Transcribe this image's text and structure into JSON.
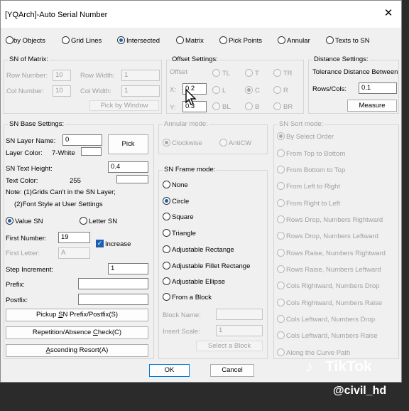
{
  "window": {
    "title": "[YQArch]-Auto Serial Number",
    "close": "✕"
  },
  "modes": [
    "by Objects",
    "Grid Lines",
    "Intersected",
    "Matrix",
    "Pick Points",
    "Annular",
    "Texts to SN"
  ],
  "matrix": {
    "title": "SN of Matrix:",
    "row_number_label": "Row Number:",
    "row_number": "10",
    "row_width_label": "Row Width:",
    "row_width": "1",
    "col_number_label": "Col Number:",
    "col_number": "10",
    "col_width_label": "Col Width:",
    "col_width": "1",
    "pick_button": "Pick by Window"
  },
  "offset": {
    "title": "Offset Settings:",
    "offset_label": "Offset",
    "x_label": "X:",
    "x_value": "0.2",
    "y_label": "Y:",
    "y_value": "0.3",
    "positions": [
      "TL",
      "T",
      "TR",
      "L",
      "C",
      "R",
      "BL",
      "B",
      "BR"
    ]
  },
  "distance": {
    "title": "Distance Settings:",
    "tolerance_label": "Tolerance Distance Between",
    "rows_cols_label": "Rows/Cols:",
    "rows_cols_value": "0.1",
    "measure_button": "Measure"
  },
  "base": {
    "title": "SN Base Settings:",
    "layer_name_label": "SN Layer Name:",
    "layer_name": "0",
    "pick_button": "Pick",
    "layer_color_label": "Layer Color:",
    "layer_color": "7-White",
    "text_height_label": "SN Text Height:",
    "text_height": "0.4",
    "text_color_label": "Text Color:",
    "text_color": "255",
    "note1": "Note: (1)Grids Can't in the SN Layer;",
    "note2": "(2)Font Style at User Settings",
    "value_sn": "Value SN",
    "letter_sn": "Letter SN",
    "first_number_label": "First Number:",
    "first_number": "19",
    "increase_label": "Increase",
    "first_letter_label": "First Letter:",
    "first_letter": "A",
    "step_label": "Step Increment:",
    "step_value": "1",
    "prefix_label": "Prefix:",
    "prefix": "",
    "postfix_label": "Postfix:",
    "postfix": "",
    "pickup_pre": "Pickup ",
    "pickup_u": "S",
    "pickup_post": "N Prefix/Postfix(S)",
    "repetition_pre": "Repetition/Absence ",
    "repetition_u": "C",
    "repetition_post": "heck(C)",
    "ascending_u": "A",
    "ascending_post": "scending Resort(A)"
  },
  "annular": {
    "title": "Annular mode:",
    "clockwise": "Clockwise",
    "anticw": "AntiCW"
  },
  "frame": {
    "title": "SN Frame mode:",
    "options": [
      "None",
      "Circle",
      "Square",
      "Triangle",
      "Adjustable Rectange",
      "Adjustable Fillet Rectange",
      "Adjustable Ellipse",
      "From a Block"
    ],
    "block_name_label": "Block Name:",
    "block_name": "",
    "insert_scale_label": "Insert Scale:",
    "insert_scale": "1",
    "select_button": "Select a Block"
  },
  "sort": {
    "title": "SN Sort mode:",
    "options": [
      "By Select Order",
      "From Top to Bottom",
      "From Bottom to Top",
      "From Left to Right",
      "From Right to Left",
      "Rows Drop, Numbers Rightward",
      "Rows Drop, Numbers Leftward",
      "Rows Raise, Numbers Rightward",
      "Rows Raise, Numbers Leftward",
      "Cols Rightward, Numbers Drop",
      "Cols Rightward, Numbers Raise",
      "Cols Leftward, Numbers Drop",
      "Cols Leftward, Numbers Raise",
      "Along the Curve Path"
    ]
  },
  "footer": {
    "ok": "OK",
    "cancel": "Cancel"
  },
  "overlay": {
    "tiktok": "TikTok",
    "handle": "@civil_hd"
  }
}
